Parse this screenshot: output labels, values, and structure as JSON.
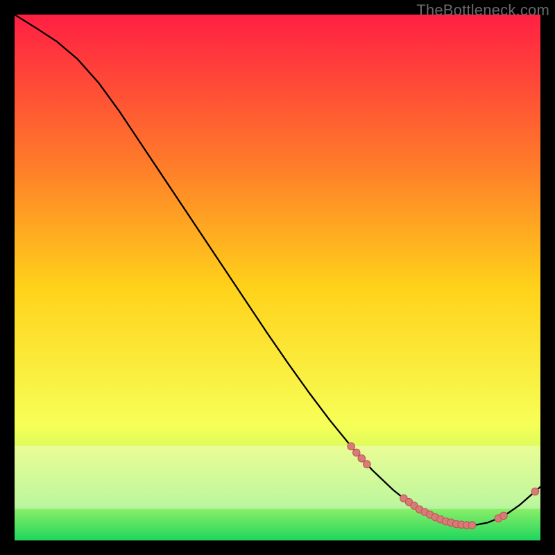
{
  "watermark": "TheBottleneck.com",
  "colors": {
    "bg": "#000000",
    "grad_top": "#ff1f43",
    "grad_mid_upper": "#ff7a2a",
    "grad_mid": "#ffd21a",
    "grad_lower": "#f7ff57",
    "grad_near_bottom": "#9cf26a",
    "grad_bottom": "#1fd65e",
    "curve": "#000000",
    "glow": "#ffffff",
    "marker_fill": "#d97a78",
    "marker_stroke": "#b95552"
  },
  "chart_data": {
    "type": "line",
    "title": "",
    "xlabel": "",
    "ylabel": "",
    "xlim": [
      0,
      100
    ],
    "ylim": [
      0,
      100
    ],
    "series": [
      {
        "name": "curve",
        "x": [
          0,
          4,
          8,
          12,
          16,
          20,
          24,
          28,
          32,
          36,
          40,
          44,
          48,
          52,
          56,
          60,
          64,
          68,
          72,
          74,
          76,
          78,
          80,
          82,
          84,
          86,
          88,
          90,
          92,
          94,
          96,
          100
        ],
        "y": [
          100,
          97.5,
          94.9,
          91.5,
          87.0,
          81.5,
          75.5,
          69.5,
          63.5,
          57.5,
          51.5,
          45.5,
          39.5,
          33.7,
          28.1,
          22.8,
          17.9,
          13.4,
          9.6,
          8.0,
          6.6,
          5.4,
          4.4,
          3.6,
          3.1,
          2.9,
          3.0,
          3.4,
          4.2,
          5.3,
          6.7,
          10.2
        ]
      }
    ],
    "markers": {
      "name": "points",
      "x": [
        64,
        65,
        66,
        67,
        74,
        75,
        76,
        77,
        78,
        79,
        80,
        81,
        82,
        83,
        84,
        85,
        86,
        87,
        92,
        93,
        99
      ],
      "y": [
        17.9,
        16.7,
        15.6,
        14.5,
        8.0,
        7.3,
        6.6,
        5.9,
        5.4,
        4.9,
        4.4,
        4.0,
        3.6,
        3.4,
        3.1,
        3.0,
        2.9,
        2.9,
        4.2,
        4.7,
        9.3
      ]
    }
  }
}
